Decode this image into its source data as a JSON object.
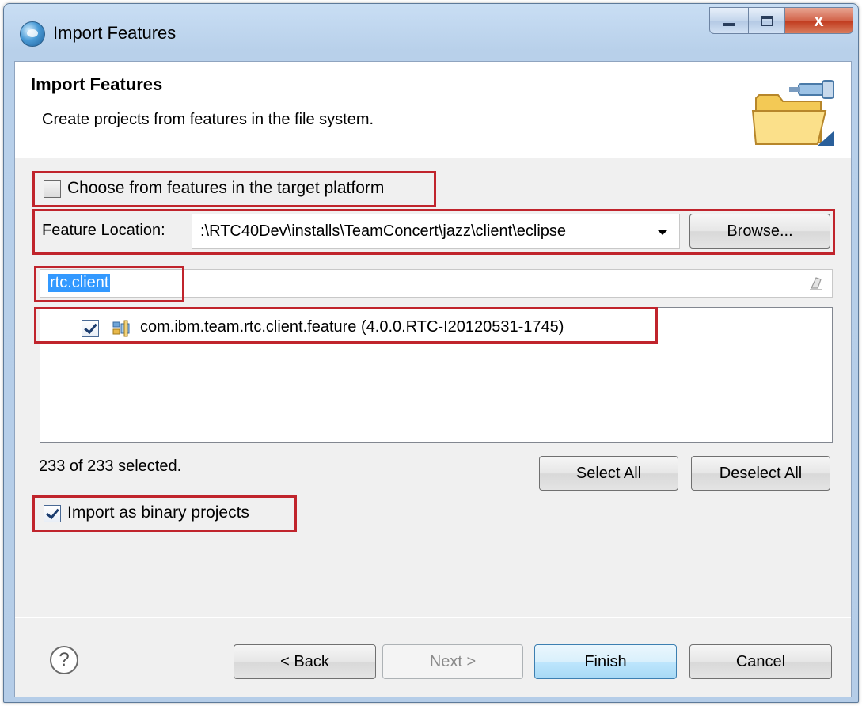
{
  "window": {
    "title": "Import Features",
    "close_glyph": "x"
  },
  "banner": {
    "title": "Import Features",
    "description": "Create projects from features in the file system.",
    "icon": "folder-plug-icon"
  },
  "target_platform": {
    "label": "Choose from features in the target platform",
    "checked": false
  },
  "feature_location": {
    "label": "Feature Location:",
    "value": ":\\RTC40Dev\\installs\\TeamConcert\\jazz\\client\\eclipse",
    "browse_label": "Browse..."
  },
  "filter": {
    "value": "rtc.client"
  },
  "feature_list": {
    "items": [
      {
        "label": "com.ibm.team.rtc.client.feature (4.0.0.RTC-I20120531-1745)",
        "checked": true
      }
    ]
  },
  "selection": {
    "status": "233 of 233 selected.",
    "select_all_label": "Select All",
    "deselect_all_label": "Deselect All"
  },
  "binary": {
    "label": "Import as binary projects",
    "checked": true
  },
  "footer": {
    "help_glyph": "?",
    "back_label": "< Back",
    "next_label": "Next >",
    "finish_label": "Finish",
    "cancel_label": "Cancel"
  },
  "colors": {
    "highlight_box": "#c0242c",
    "selection": "#3399ff"
  }
}
